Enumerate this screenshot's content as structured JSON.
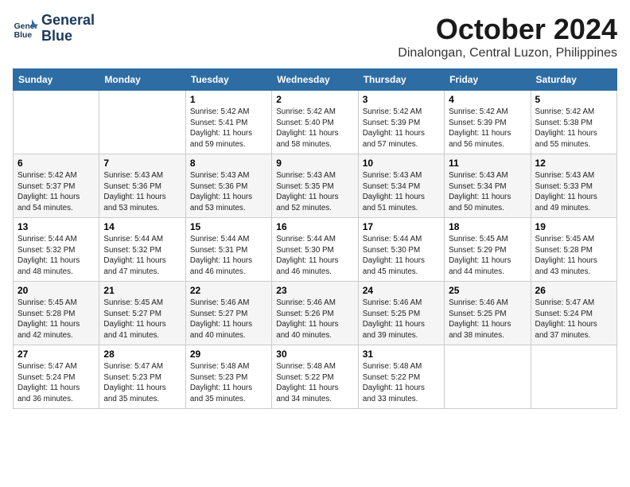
{
  "logo": {
    "line1": "General",
    "line2": "Blue"
  },
  "title": "October 2024",
  "location": "Dinalongan, Central Luzon, Philippines",
  "headers": [
    "Sunday",
    "Monday",
    "Tuesday",
    "Wednesday",
    "Thursday",
    "Friday",
    "Saturday"
  ],
  "weeks": [
    [
      {
        "day": "",
        "content": ""
      },
      {
        "day": "",
        "content": ""
      },
      {
        "day": "1",
        "content": "Sunrise: 5:42 AM\nSunset: 5:41 PM\nDaylight: 11 hours\nand 59 minutes."
      },
      {
        "day": "2",
        "content": "Sunrise: 5:42 AM\nSunset: 5:40 PM\nDaylight: 11 hours\nand 58 minutes."
      },
      {
        "day": "3",
        "content": "Sunrise: 5:42 AM\nSunset: 5:39 PM\nDaylight: 11 hours\nand 57 minutes."
      },
      {
        "day": "4",
        "content": "Sunrise: 5:42 AM\nSunset: 5:39 PM\nDaylight: 11 hours\nand 56 minutes."
      },
      {
        "day": "5",
        "content": "Sunrise: 5:42 AM\nSunset: 5:38 PM\nDaylight: 11 hours\nand 55 minutes."
      }
    ],
    [
      {
        "day": "6",
        "content": "Sunrise: 5:42 AM\nSunset: 5:37 PM\nDaylight: 11 hours\nand 54 minutes."
      },
      {
        "day": "7",
        "content": "Sunrise: 5:43 AM\nSunset: 5:36 PM\nDaylight: 11 hours\nand 53 minutes."
      },
      {
        "day": "8",
        "content": "Sunrise: 5:43 AM\nSunset: 5:36 PM\nDaylight: 11 hours\nand 53 minutes."
      },
      {
        "day": "9",
        "content": "Sunrise: 5:43 AM\nSunset: 5:35 PM\nDaylight: 11 hours\nand 52 minutes."
      },
      {
        "day": "10",
        "content": "Sunrise: 5:43 AM\nSunset: 5:34 PM\nDaylight: 11 hours\nand 51 minutes."
      },
      {
        "day": "11",
        "content": "Sunrise: 5:43 AM\nSunset: 5:34 PM\nDaylight: 11 hours\nand 50 minutes."
      },
      {
        "day": "12",
        "content": "Sunrise: 5:43 AM\nSunset: 5:33 PM\nDaylight: 11 hours\nand 49 minutes."
      }
    ],
    [
      {
        "day": "13",
        "content": "Sunrise: 5:44 AM\nSunset: 5:32 PM\nDaylight: 11 hours\nand 48 minutes."
      },
      {
        "day": "14",
        "content": "Sunrise: 5:44 AM\nSunset: 5:32 PM\nDaylight: 11 hours\nand 47 minutes."
      },
      {
        "day": "15",
        "content": "Sunrise: 5:44 AM\nSunset: 5:31 PM\nDaylight: 11 hours\nand 46 minutes."
      },
      {
        "day": "16",
        "content": "Sunrise: 5:44 AM\nSunset: 5:30 PM\nDaylight: 11 hours\nand 46 minutes."
      },
      {
        "day": "17",
        "content": "Sunrise: 5:44 AM\nSunset: 5:30 PM\nDaylight: 11 hours\nand 45 minutes."
      },
      {
        "day": "18",
        "content": "Sunrise: 5:45 AM\nSunset: 5:29 PM\nDaylight: 11 hours\nand 44 minutes."
      },
      {
        "day": "19",
        "content": "Sunrise: 5:45 AM\nSunset: 5:28 PM\nDaylight: 11 hours\nand 43 minutes."
      }
    ],
    [
      {
        "day": "20",
        "content": "Sunrise: 5:45 AM\nSunset: 5:28 PM\nDaylight: 11 hours\nand 42 minutes."
      },
      {
        "day": "21",
        "content": "Sunrise: 5:45 AM\nSunset: 5:27 PM\nDaylight: 11 hours\nand 41 minutes."
      },
      {
        "day": "22",
        "content": "Sunrise: 5:46 AM\nSunset: 5:27 PM\nDaylight: 11 hours\nand 40 minutes."
      },
      {
        "day": "23",
        "content": "Sunrise: 5:46 AM\nSunset: 5:26 PM\nDaylight: 11 hours\nand 40 minutes."
      },
      {
        "day": "24",
        "content": "Sunrise: 5:46 AM\nSunset: 5:25 PM\nDaylight: 11 hours\nand 39 minutes."
      },
      {
        "day": "25",
        "content": "Sunrise: 5:46 AM\nSunset: 5:25 PM\nDaylight: 11 hours\nand 38 minutes."
      },
      {
        "day": "26",
        "content": "Sunrise: 5:47 AM\nSunset: 5:24 PM\nDaylight: 11 hours\nand 37 minutes."
      }
    ],
    [
      {
        "day": "27",
        "content": "Sunrise: 5:47 AM\nSunset: 5:24 PM\nDaylight: 11 hours\nand 36 minutes."
      },
      {
        "day": "28",
        "content": "Sunrise: 5:47 AM\nSunset: 5:23 PM\nDaylight: 11 hours\nand 35 minutes."
      },
      {
        "day": "29",
        "content": "Sunrise: 5:48 AM\nSunset: 5:23 PM\nDaylight: 11 hours\nand 35 minutes."
      },
      {
        "day": "30",
        "content": "Sunrise: 5:48 AM\nSunset: 5:22 PM\nDaylight: 11 hours\nand 34 minutes."
      },
      {
        "day": "31",
        "content": "Sunrise: 5:48 AM\nSunset: 5:22 PM\nDaylight: 11 hours\nand 33 minutes."
      },
      {
        "day": "",
        "content": ""
      },
      {
        "day": "",
        "content": ""
      }
    ]
  ]
}
